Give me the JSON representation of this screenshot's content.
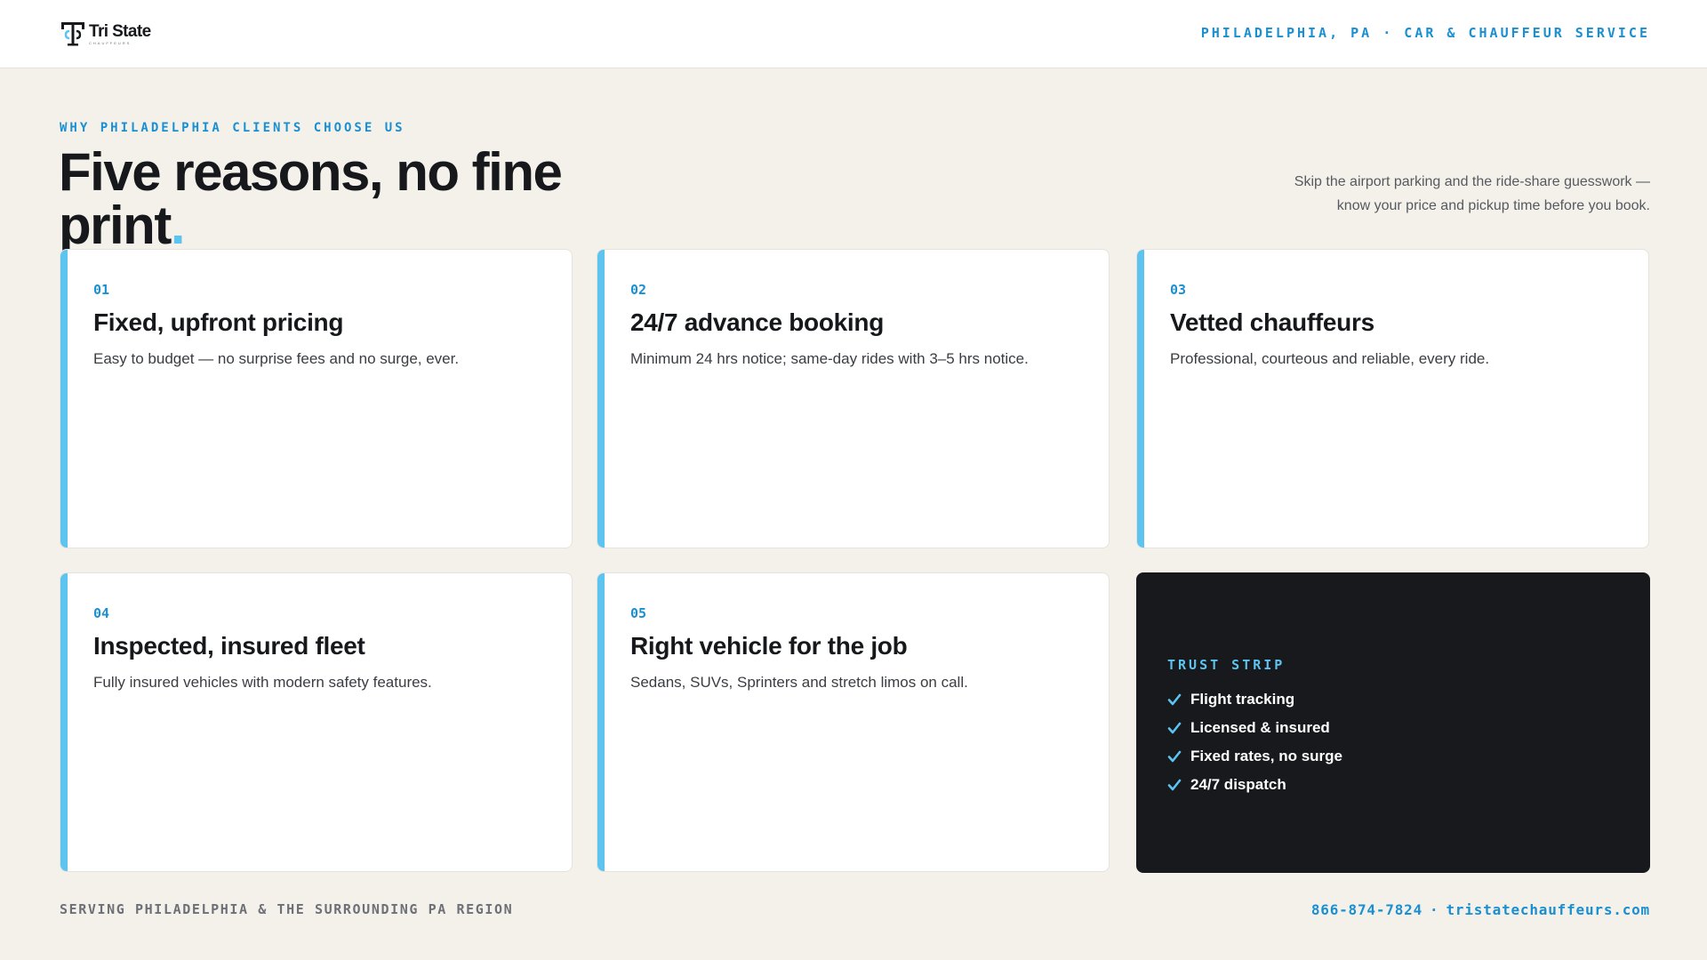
{
  "header": {
    "logo": {
      "name": "Tri State",
      "sub": "CHAUFFEURS",
      "mark_icon": "tsc-monogram-icon"
    },
    "tagline": "PHILADELPHIA, PA · CAR & CHAUFFEUR SERVICE"
  },
  "hero": {
    "eyebrow": "WHY PHILADELPHIA CLIENTS CHOOSE US",
    "headline": "Five reasons, no fine print",
    "headline_dot": ".",
    "lede": "Skip the airport parking and the ride-share guesswork — know your price and pickup time before you book."
  },
  "reasons": [
    {
      "num": "01",
      "title": "Fixed, upfront pricing",
      "desc": "Easy to budget — no surprise fees and no surge, ever."
    },
    {
      "num": "02",
      "title": "24/7 advance booking",
      "desc": "Minimum 24 hrs notice; same-day rides with 3–5 hrs notice."
    },
    {
      "num": "03",
      "title": "Vetted chauffeurs",
      "desc": "Professional, courteous and reliable, every ride."
    },
    {
      "num": "04",
      "title": "Inspected, insured fleet",
      "desc": "Fully insured vehicles with modern safety features."
    },
    {
      "num": "05",
      "title": "Right vehicle for the job",
      "desc": "Sedans, SUVs, Sprinters and stretch limos on call."
    }
  ],
  "trust": {
    "label": "TRUST STRIP",
    "items": [
      "Flight tracking",
      "Licensed & insured",
      "Fixed rates, no surge",
      "24/7 dispatch"
    ],
    "check_icon": "check-icon"
  },
  "footer": {
    "region": "SERVING PHILADELPHIA & THE SURROUNDING PA REGION",
    "phone": "866-874-7824",
    "separator": "·",
    "website": "tristatechauffeurs.com"
  },
  "colors": {
    "accent": "#1a8fd1",
    "accent_light": "#5cc4ef",
    "page_bg": "#f4f1eb",
    "dark_panel": "#17191d"
  }
}
